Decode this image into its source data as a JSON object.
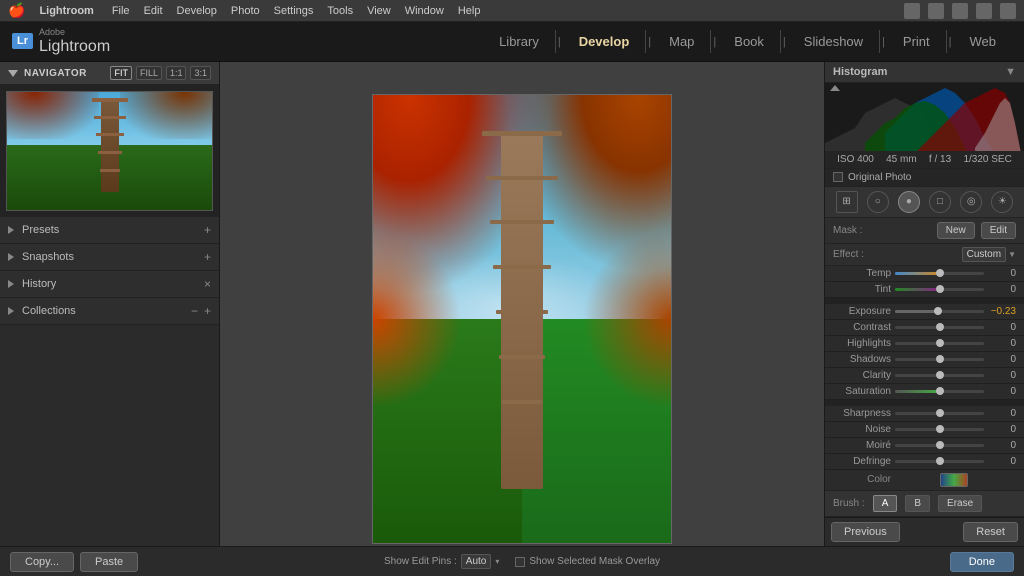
{
  "app": {
    "name": "Lightroom",
    "adobe": "Adobe",
    "badge": "Lr"
  },
  "menubar": {
    "apple": "🍎",
    "items": [
      "Lightroom",
      "File",
      "Edit",
      "Develop",
      "Photo",
      "Settings",
      "Tools",
      "View",
      "Window",
      "Help"
    ]
  },
  "nav": {
    "tabs": [
      "Library",
      "Develop",
      "Map",
      "Book",
      "Slideshow",
      "Print",
      "Web"
    ],
    "active": "Develop",
    "separator": "|"
  },
  "left_panel": {
    "navigator": {
      "label": "Navigator",
      "zoom_options": [
        "FIT",
        "FILL",
        "1:1",
        "3:1"
      ]
    },
    "sections": [
      {
        "label": "Presets",
        "action": "+"
      },
      {
        "label": "Snapshots",
        "action": "+"
      },
      {
        "label": "History",
        "action": "×"
      },
      {
        "label": "Collections",
        "actions": [
          "−",
          "+"
        ]
      }
    ]
  },
  "bottom_bar": {
    "copy_label": "Copy...",
    "paste_label": "Paste",
    "edit_pins_label": "Show Edit Pins :",
    "edit_pins_value": "Auto",
    "mask_overlay_label": "Show Selected Mask Overlay",
    "done_label": "Done"
  },
  "right_panel": {
    "histogram_label": "Histogram",
    "exif": {
      "iso": "ISO 400",
      "focal": "45 mm",
      "aperture": "f / 13",
      "shutter": "1/320 SEC"
    },
    "original_photo": "Original Photo",
    "mask_label": "Mask :",
    "new_btn": "New",
    "edit_btn": "Edit",
    "effect_label": "Effect :",
    "effect_value": "Custom",
    "sliders": [
      {
        "label": "Temp",
        "value": "0",
        "position": 50,
        "fill_color": "#4a8a4a"
      },
      {
        "label": "Tint",
        "value": "0",
        "position": 50,
        "fill_color": "#884a8a"
      },
      {
        "label": "Exposure",
        "value": "−0.23",
        "position": 46,
        "fill_color": "#888"
      },
      {
        "label": "Contrast",
        "value": "0",
        "position": 50,
        "fill_color": "#888"
      },
      {
        "label": "Highlights",
        "value": "0",
        "position": 50,
        "fill_color": "#888"
      },
      {
        "label": "Shadows",
        "value": "0",
        "position": 50,
        "fill_color": "#888"
      },
      {
        "label": "Clarity",
        "value": "0",
        "position": 50,
        "fill_color": "#888"
      },
      {
        "label": "Saturation",
        "value": "0",
        "position": 50,
        "fill_color": "#4a8a4a"
      }
    ],
    "sliders2": [
      {
        "label": "Sharpness",
        "value": "0",
        "position": 50
      },
      {
        "label": "Noise",
        "value": "0",
        "position": 50
      },
      {
        "label": "Moiré",
        "value": "0",
        "position": 50
      },
      {
        "label": "Defringe",
        "value": "0",
        "position": 50
      }
    ],
    "color_label": "Color",
    "brush_label": "Brush :",
    "brush_options": [
      "A",
      "B",
      "Erase"
    ],
    "previous_label": "Previous",
    "reset_label": "Reset"
  },
  "colors": {
    "active_tab": "#e8d5a3",
    "brand_blue": "#4a90d9",
    "bg_dark": "#2b2b2b",
    "bg_darker": "#1a1a1a",
    "border": "#444",
    "text_light": "#ccc",
    "text_mid": "#999",
    "accent_red": "#cc3300",
    "accent_green": "#33aa44",
    "accent_blue": "#3388cc"
  }
}
